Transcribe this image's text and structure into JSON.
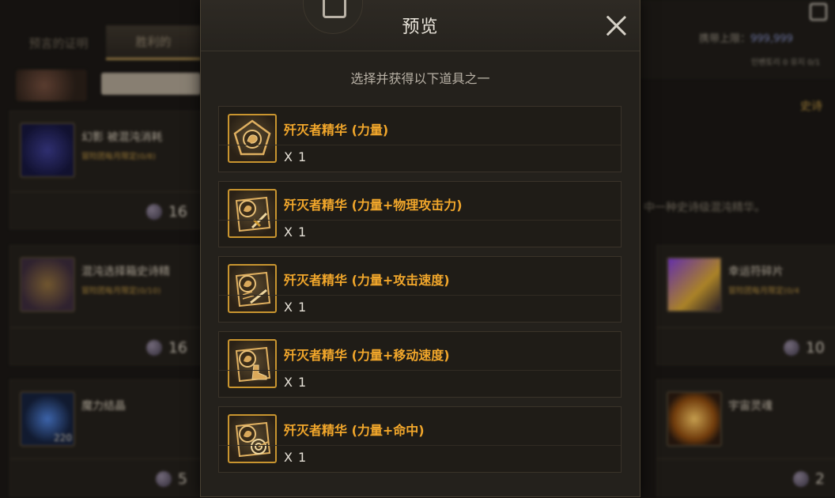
{
  "background": {
    "tabs": [
      "预言的证明",
      "胜利的"
    ],
    "cards_left": [
      {
        "name": "幻影 被混沌消耗",
        "limit": "冒险团每月限定(0/8)",
        "price": "16"
      },
      {
        "name": "混沌选择箱史诗精",
        "limit": "冒险团每月限定(0/10)",
        "price": "16"
      },
      {
        "name": "魔力结晶",
        "limit": "",
        "price": "5",
        "badge": "220"
      }
    ],
    "cards_right": [
      {
        "name": "幸运符碎片",
        "limit": "冒险团每月限定(0/4",
        "price": "10"
      },
      {
        "name": "宇宙灵魂",
        "limit": "",
        "price": "2"
      }
    ],
    "right_top": {
      "carry_label": "携带上限：",
      "carry_value": "999,999",
      "small_note": "인벤토리 0 유지 0/1",
      "gold_tab": "史诗"
    },
    "mid_desc": "中一种史诗级混沌精华。"
  },
  "modal": {
    "title": "预览",
    "subtitle": "选择并获得以下道具之一",
    "items": [
      {
        "name": "歼灭者精华 (力量)",
        "qty": "X 1",
        "icon": "essence-pentagon-icon"
      },
      {
        "name": "歼灭者精华 (力量+物理攻击力)",
        "qty": "X 1",
        "icon": "essence-sword-icon"
      },
      {
        "name": "歼灭者精华 (力量+攻击速度)",
        "qty": "X 1",
        "icon": "essence-speed-sword-icon"
      },
      {
        "name": "歼灭者精华 (力量+移动速度)",
        "qty": "X 1",
        "icon": "essence-boot-icon"
      },
      {
        "name": "歼灭者精华 (力量+命中)",
        "qty": "X 1",
        "icon": "essence-target-icon"
      }
    ]
  },
  "colors": {
    "item_name": "#f2a72b",
    "icon_border": "#c9952f",
    "limit_text": "#b28c3f"
  }
}
